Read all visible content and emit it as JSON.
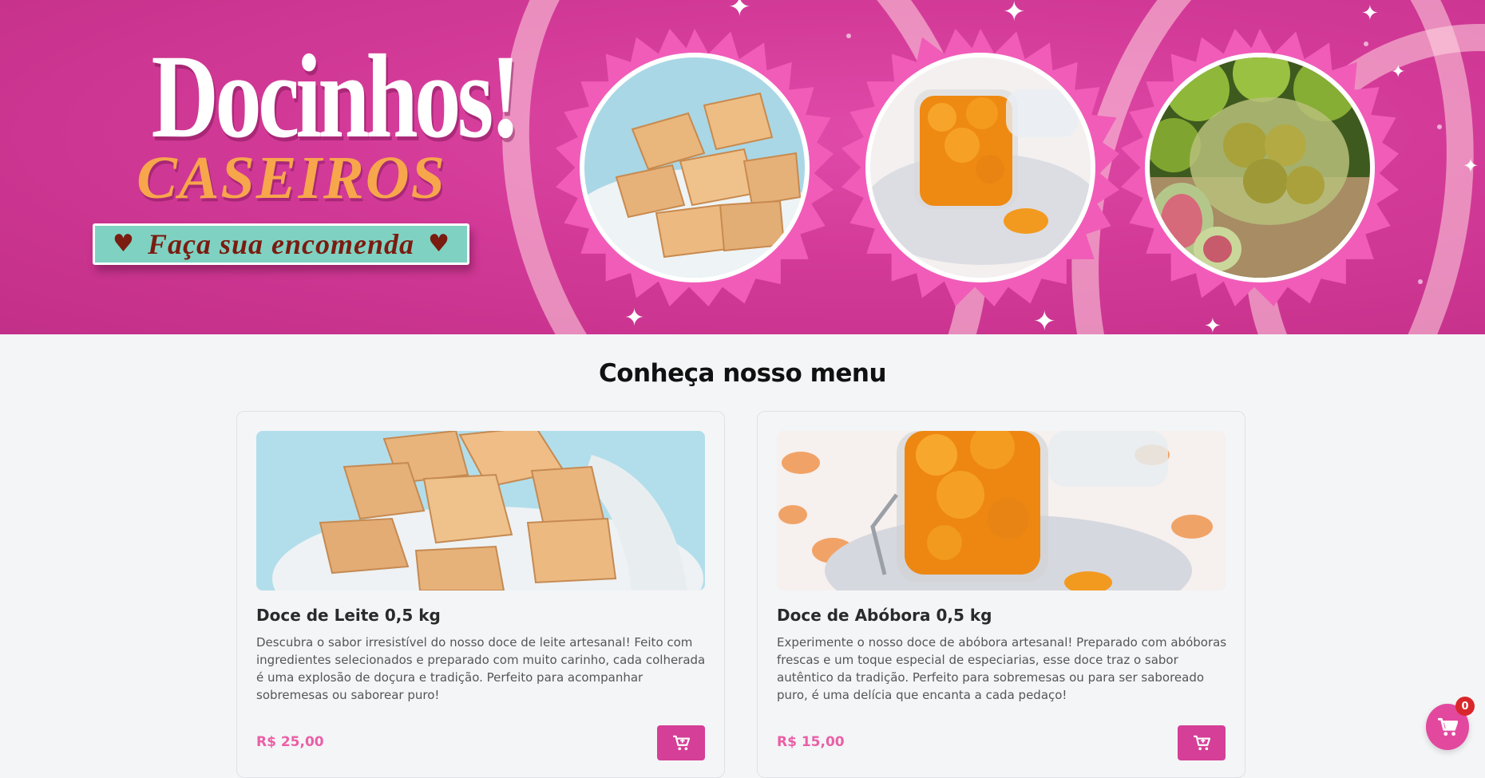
{
  "hero": {
    "logo_main": "Docinhos!",
    "logo_sub": "CASEIROS",
    "order_button_label": "Faça sua encomenda"
  },
  "menu": {
    "title": "Conheça nosso menu",
    "items": [
      {
        "name": "Doce de Leite 0,5 kg",
        "description": "Descubra o sabor irresistível do nosso doce de leite artesanal! Feito com ingredientes selecionados e preparado com muito carinho, cada colherada é uma explosão de doçura e tradição. Perfeito para acompanhar sobremesas ou saborear puro!",
        "price": "R$ 25,00",
        "image_icon": "doce-de-leite-photo"
      },
      {
        "name": "Doce de Abóbora 0,5 kg",
        "description": "Experimente o nosso doce de abóbora artesanal! Preparado com abóboras frescas e um toque especial de especiarias, esse doce traz o sabor autêntico da tradição. Perfeito para sobremesas ou para ser saboreado puro, é uma delícia que encanta a cada pedaço!",
        "price": "R$ 15,00",
        "image_icon": "doce-de-abobora-photo"
      }
    ]
  },
  "cart": {
    "count": "0",
    "icon": "cart-icon"
  },
  "colors": {
    "brand_pink": "#d53f97",
    "price_pink": "#ea5fa6",
    "banner_teal": "#7fd2c2",
    "logo_orange": "#f7a64c"
  }
}
